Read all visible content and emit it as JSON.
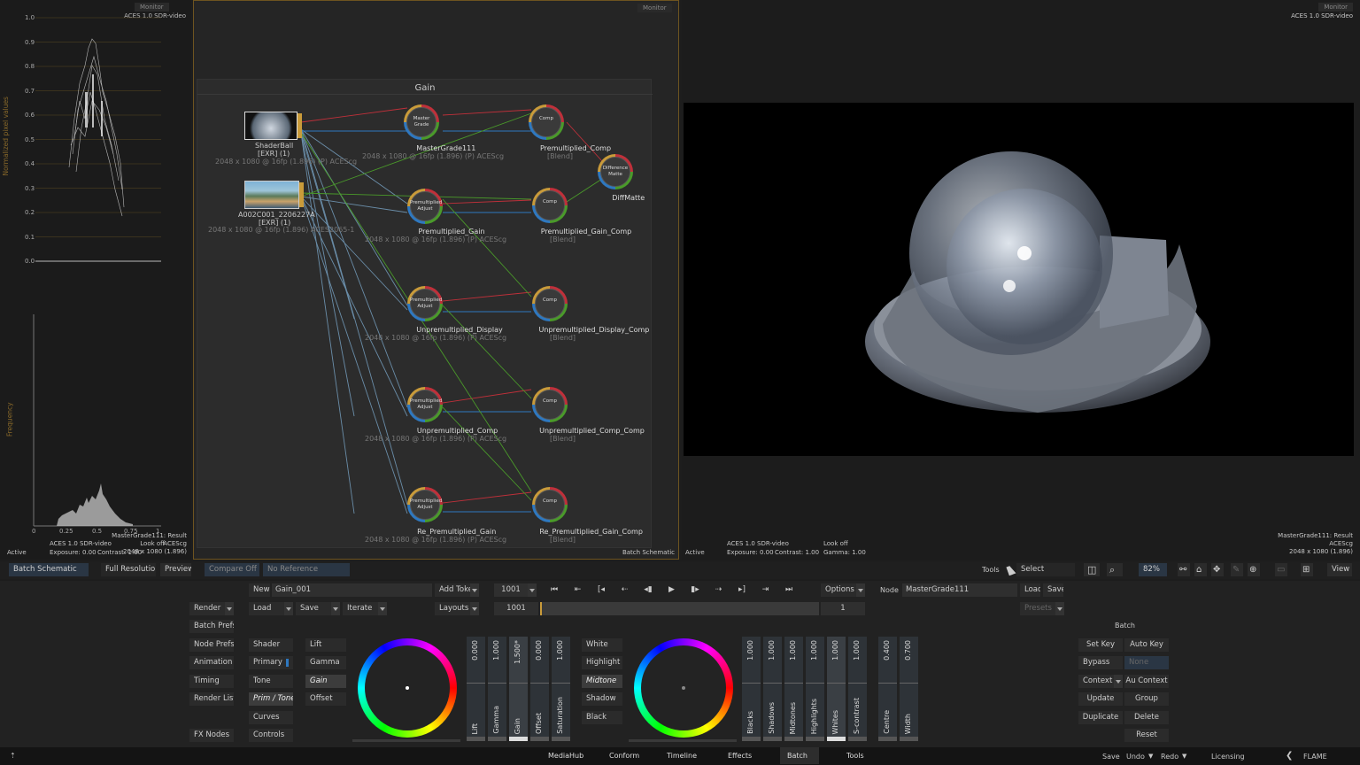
{
  "monitors": {
    "left_label": "Monitor",
    "mid_label": "Monitor",
    "right_label": "Monitor"
  },
  "scopes": {
    "color_space": "ACES 1.0 SDR-video",
    "waveform_ylabel": "Normalized pixel values",
    "waveform_ticks": [
      "1.0",
      "0.9",
      "0.8",
      "0.7",
      "0.6",
      "0.5",
      "0.4",
      "0.3",
      "0.2",
      "0.1",
      "0.0"
    ],
    "hist_ylabel": "Frequency",
    "hist_ticks": [
      "0",
      "0.25",
      "0.5",
      "0.75",
      "1"
    ],
    "footer_cs": "ACES 1.0 SDR-video",
    "footer_exposure": "Exposure: 0.00",
    "footer_contrast": "Contrast: 1.00",
    "footer_node": "MasterGrade111: Result",
    "footer_look": "Look off",
    "footer_acescg": "ACEScg",
    "footer_res": "2048 x 1080 (1.896)",
    "active": "Active"
  },
  "schematic": {
    "group_title": "Gain",
    "footer": "Batch Schematic",
    "nodes": {
      "shaderball": {
        "name": "ShaderBall",
        "sub": "[EXR] (1)",
        "info": "2048 x 1080 @ 16fp (1.896) (P) ACEScg"
      },
      "clip": {
        "name": "A002C001_2206227A",
        "sub": "[EXR] (1)",
        "info": "2048 x 1080 @ 16fp (1.896) ACES2065-1"
      },
      "mastergrade": {
        "name": "MasterGrade111",
        "inner": "Master Grade",
        "info": "2048 x 1080 @ 16fp (1.896) (P) ACEScg"
      },
      "premult_comp": {
        "name": "Premultiplied_Comp",
        "inner": "Comp",
        "info": "[Blend]"
      },
      "diffmatte": {
        "name": "DiffMatte",
        "inner": "Difference Matte"
      },
      "premult_gain": {
        "name": "Premultiplied_Gain",
        "inner": "Premultiplied Adjust",
        "info": "2048 x 1080 @ 16fp (1.896) (P) ACEScg"
      },
      "premult_gain_comp": {
        "name": "Premultiplied_Gain_Comp",
        "inner": "Comp",
        "info": "[Blend]"
      },
      "unpremult_display": {
        "name": "Unpremultiplied_Display",
        "inner": "Premultiplied Adjust",
        "info": "2048 x 1080 @ 16fp (1.896) (P) ACEScg"
      },
      "unpremult_display_comp": {
        "name": "Unpremultiplied_Display_Comp",
        "inner": "Comp",
        "info": "[Blend]"
      },
      "unpremult_comp": {
        "name": "Unpremultiplied_Comp",
        "inner": "Premultiplied Adjust",
        "info": "2048 x 1080 @ 16fp (1.896) (P) ACEScg"
      },
      "unpremult_comp_comp": {
        "name": "Unpremultiplied_Comp_Comp",
        "inner": "Comp",
        "info": "[Blend]"
      },
      "repremult_gain": {
        "name": "Re_Premultiplied_Gain",
        "inner": "Premultiplied Adjust",
        "info": "2048 x 1080 @ 16fp (1.896) (P) ACEScg"
      },
      "repremult_gain_comp": {
        "name": "Re_Premultiplied_Gain_Comp",
        "inner": "Comp",
        "info": "[Blend]"
      }
    }
  },
  "viewer": {
    "color_space": "ACES 1.0 SDR-video",
    "footer_cs": "ACES 1.0 SDR-video",
    "footer_exposure": "Exposure: 0.00",
    "footer_contrast": "Contrast: 1.00",
    "footer_look": "Look off",
    "footer_gamma": "Gamma: 1.00",
    "footer_node": "MasterGrade111: Result",
    "footer_acescg": "ACEScg",
    "footer_res": "2048 x 1080 (1.896)",
    "active": "Active"
  },
  "toolbar": {
    "batch_schematic": "Batch Schematic",
    "full_resolution": "Full Resolution",
    "preview": "Preview",
    "compare_off": "Compare Off",
    "no_reference": "No Reference",
    "tools": "Tools",
    "select": "Select",
    "zoom": "82%",
    "view": "View"
  },
  "controls": {
    "new": "New",
    "setup_name": "Gain_001",
    "add_token": "Add Token",
    "frame": "1001",
    "frame2": "1001",
    "frame_count": "1",
    "options": "Options",
    "node_label": "Node",
    "node_name": "MasterGrade111",
    "load": "Load",
    "save": "Save",
    "presets": "Presets",
    "render": "Render",
    "load2": "Load",
    "save2": "Save",
    "iterate": "Iterate",
    "layouts": "Layouts",
    "batch_prefs": "Batch Prefs",
    "node_prefs": "Node Prefs",
    "animation": "Animation",
    "timing": "Timing",
    "render_list": "Render List",
    "fx_nodes": "FX Nodes",
    "shader": "Shader",
    "primary": "Primary",
    "tone": "Tone",
    "prim_tone": "Prim / Tone",
    "curves": "Curves",
    "controls": "Controls",
    "lift": "Lift",
    "gamma": "Gamma",
    "gain": "Gain",
    "offset": "Offset",
    "white": "White",
    "highlight": "Highlight",
    "midtone": "Midtone",
    "shadow": "Shadow",
    "black": "Black",
    "batch_title": "Batch",
    "set_key": "Set Key",
    "auto_key": "Auto Key",
    "bypass": "Bypass",
    "none": "None",
    "context": "Context",
    "au_context": "Au Context",
    "update": "Update",
    "group": "Group",
    "duplicate": "Duplicate",
    "delete": "Delete",
    "reset": "Reset"
  },
  "sliders1": [
    {
      "value": "0.000",
      "label": "Lift"
    },
    {
      "value": "1.000",
      "label": "Gamma"
    },
    {
      "value": "1.500*",
      "label": "Gain"
    },
    {
      "value": "0.000",
      "label": "Offset"
    },
    {
      "value": "1.000",
      "label": "Saturation"
    }
  ],
  "sliders2": [
    {
      "value": "1.000",
      "label": "Blacks"
    },
    {
      "value": "1.000",
      "label": "Shadows"
    },
    {
      "value": "1.000",
      "label": "Midtones"
    },
    {
      "value": "1.000",
      "label": "Highlights"
    },
    {
      "value": "1.000",
      "label": "Whites"
    },
    {
      "value": "1.000",
      "label": "S-contrast"
    }
  ],
  "sliders3": [
    {
      "value": "0.400",
      "label": "Centre"
    },
    {
      "value": "0.700",
      "label": "Width"
    }
  ],
  "tabs": [
    "MediaHub",
    "Conform",
    "Timeline",
    "Effects",
    "Batch",
    "Tools"
  ],
  "active_tab": "Batch",
  "bottom": {
    "save": "Save",
    "undo": "Undo",
    "redo": "Redo",
    "licensing": "Licensing",
    "brand": "FLAME"
  },
  "colors": {
    "accent": "#c99b3a",
    "link_red": "#c0303a",
    "link_blue": "#2e78c0",
    "link_green": "#4a9a2a"
  }
}
